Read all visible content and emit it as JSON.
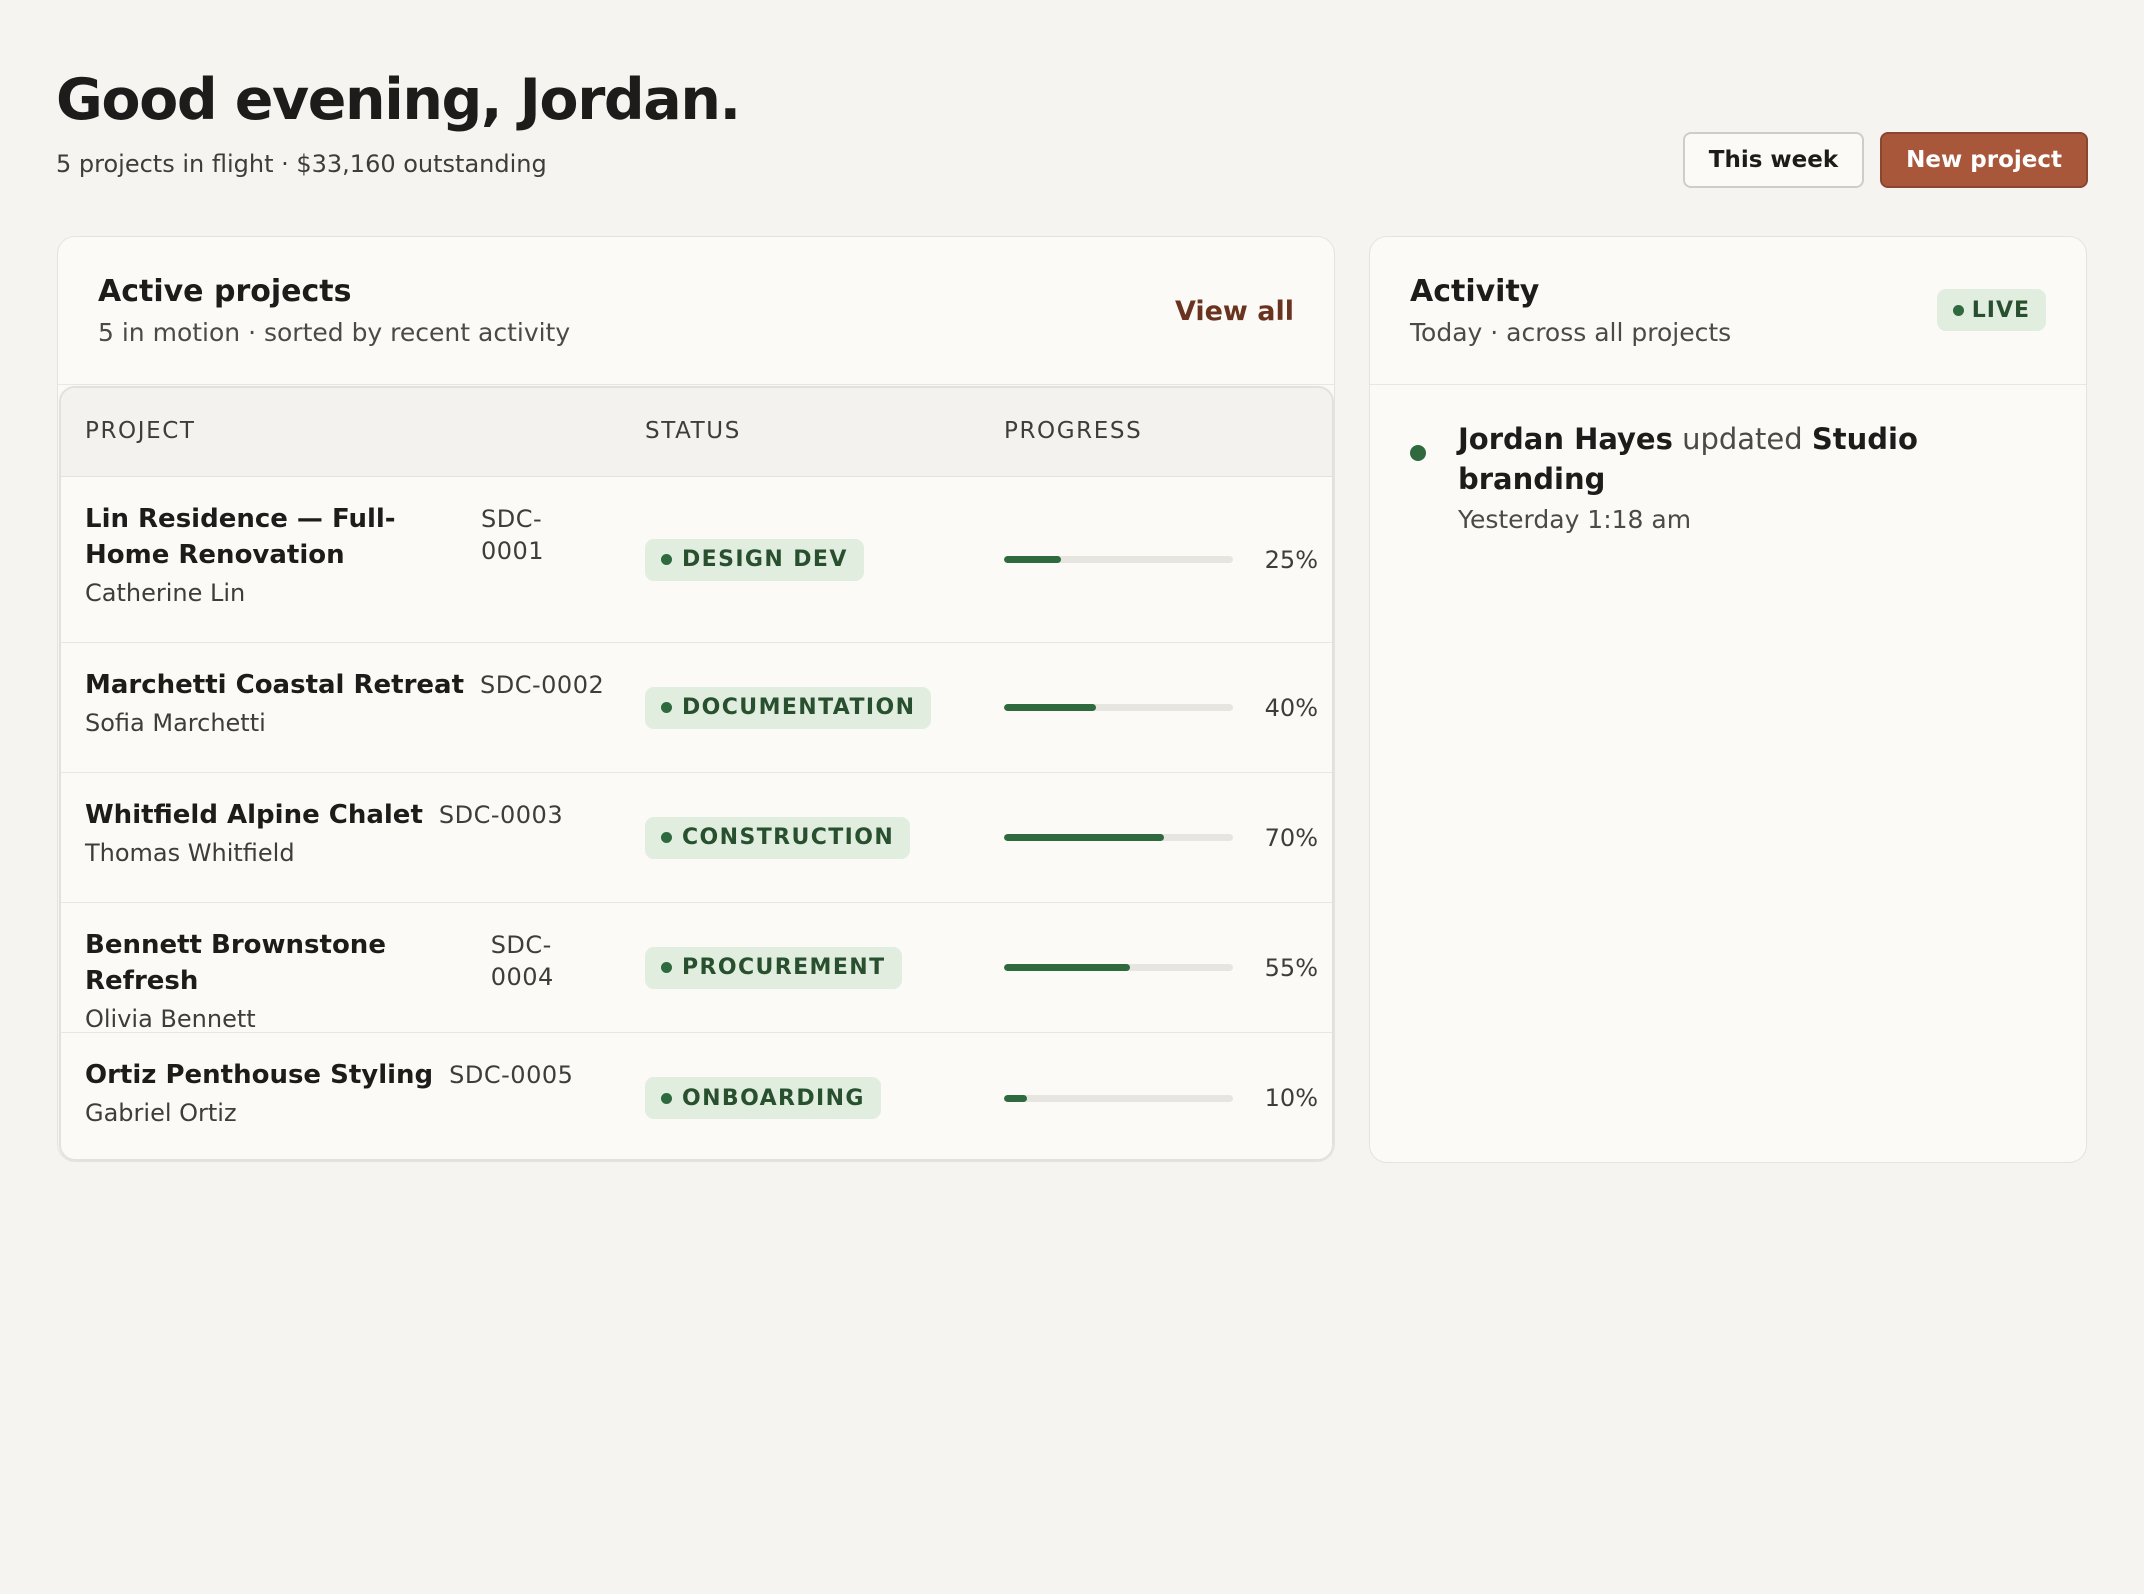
{
  "header": {
    "greeting": "Good evening, Jordan.",
    "summary": "5 projects in flight · $33,160 outstanding",
    "this_week_label": "This week",
    "new_project_label": "New project"
  },
  "projects_card": {
    "title": "Active projects",
    "subtitle": "5 in motion · sorted by recent activity",
    "view_all_label": "View all",
    "columns": [
      "PROJECT",
      "STATUS",
      "PROGRESS"
    ],
    "rows": [
      {
        "name": "Lin Residence — Full-Home Renovation",
        "code": "SDC-0001",
        "client": "Catherine Lin",
        "status": "DESIGN DEV",
        "progress": 25,
        "progress_label": "25%"
      },
      {
        "name": "Marchetti Coastal Retreat",
        "code": "SDC-0002",
        "client": "Sofia Marchetti",
        "status": "DOCUMENTATION",
        "progress": 40,
        "progress_label": "40%"
      },
      {
        "name": "Whitfield Alpine Chalet",
        "code": "SDC-0003",
        "client": "Thomas Whitfield",
        "status": "CONSTRUCTION",
        "progress": 70,
        "progress_label": "70%"
      },
      {
        "name": "Bennett Brownstone Refresh",
        "code": "SDC-0004",
        "client": "Olivia Bennett",
        "status": "PROCUREMENT",
        "progress": 55,
        "progress_label": "55%"
      },
      {
        "name": "Ortiz Penthouse Styling",
        "code": "SDC-0005",
        "client": "Gabriel Ortiz",
        "status": "ONBOARDING",
        "progress": 10,
        "progress_label": "10%"
      }
    ]
  },
  "activity_card": {
    "title": "Activity",
    "subtitle": "Today · across all projects",
    "live_label": "LIVE",
    "items": [
      {
        "actor": "Jordan Hayes",
        "verb": "updated",
        "target": "Studio branding",
        "time": "Yesterday 1:18 am"
      }
    ]
  },
  "colors": {
    "background": "#f5f4f0",
    "card": "#fbfaf6",
    "accent": "#a9573b",
    "status_green": "#2e6a3e",
    "status_pill_bg": "#e0eddf",
    "link": "#6a3320"
  },
  "icons": [
    "status-dot-icon",
    "live-dot-icon",
    "activity-dot-icon"
  ]
}
